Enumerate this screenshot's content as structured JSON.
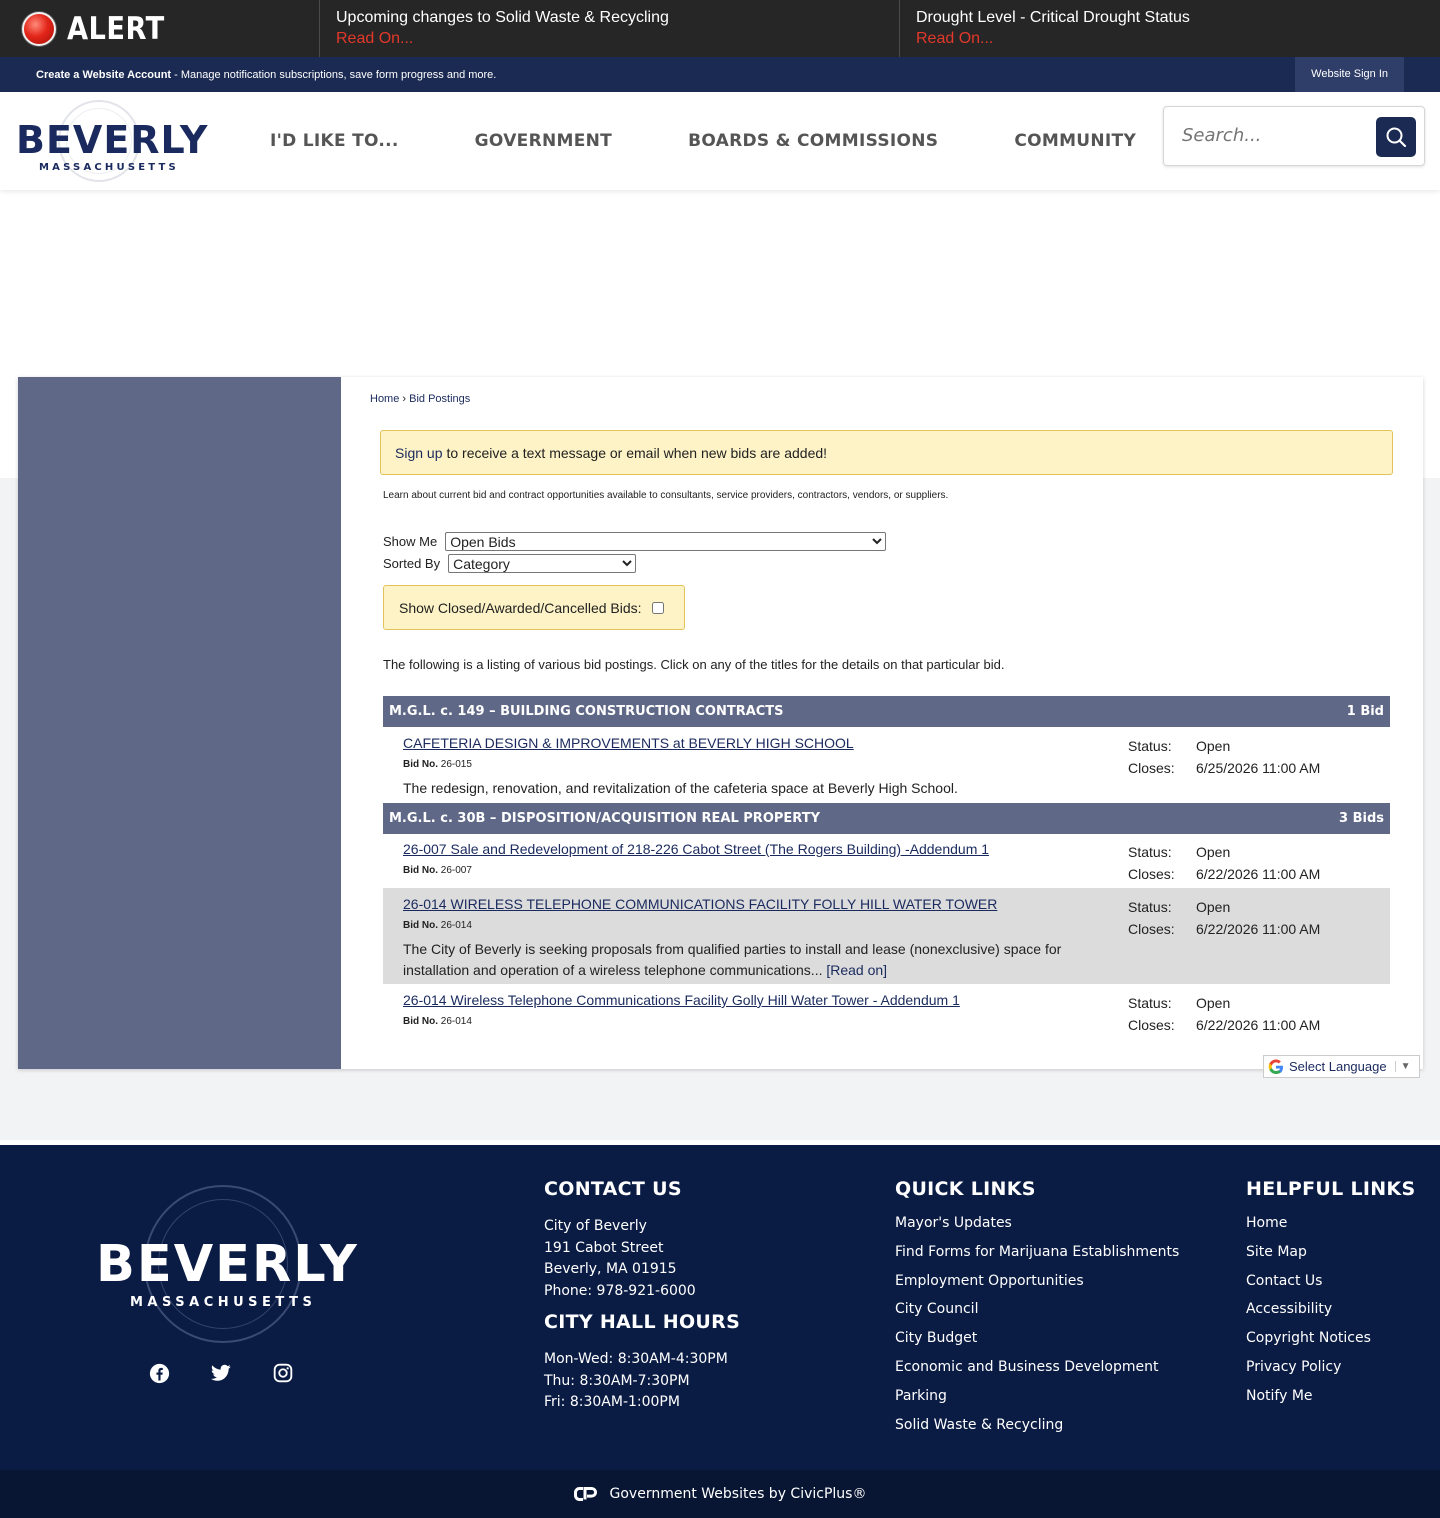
{
  "alert": {
    "label": "ALERT",
    "items": [
      {
        "title": "Upcoming changes to Solid Waste & Recycling",
        "link": "Read On..."
      },
      {
        "title": "Drought Level - Critical Drought Status",
        "link": "Read On..."
      }
    ]
  },
  "account": {
    "create_bold": "Create a Website Account",
    "create_rest": " - Manage notification subscriptions, save form progress and more.",
    "signin": "Website Sign In"
  },
  "header": {
    "logo_word": "BEVERLY",
    "logo_sub": "MASSACHUSETTS",
    "nav": [
      "I'D LIKE TO...",
      "GOVERNMENT",
      "BOARDS & COMMISSIONS",
      "COMMUNITY"
    ],
    "search_placeholder": "Search..."
  },
  "breadcrumb": {
    "home": "Home",
    "sep": " › ",
    "current": "Bid Postings"
  },
  "notice": {
    "link": "Sign up",
    "text": "to receive a text message or email when new bids are added!"
  },
  "intro": "Learn about current bid and contract opportunities available to consultants, service providers, contractors, vendors, or suppliers.",
  "filters": {
    "show_me_label": "Show Me",
    "show_me_value": "Open Bids",
    "sorted_by_label": "Sorted By",
    "sorted_by_value": "Category",
    "closed_label": "Show Closed/Awarded/Cancelled Bids:"
  },
  "listing_intro": "The following is a listing of various bid postings. Click on any of the titles for the details on that particular bid.",
  "categories": [
    {
      "name": "M.G.L. c. 149 – BUILDING CONSTRUCTION CONTRACTS",
      "count": "1 Bid",
      "bids": [
        {
          "title": "CAFETERIA DESIGN & IMPROVEMENTS at BEVERLY HIGH SCHOOL",
          "bid_no_label": "Bid No.",
          "bid_no": "26-015",
          "desc": "The redesign, renovation, and revitalization of the cafeteria space at Beverly High School.",
          "read_on": "",
          "status_label": "Status:",
          "status": "Open",
          "closes_label": "Closes:",
          "closes": "6/25/2026 11:00 AM"
        }
      ]
    },
    {
      "name": "M.G.L. c. 30B – DISPOSITION/ACQUISITION REAL PROPERTY",
      "count": "3 Bids",
      "bids": [
        {
          "title": "26-007 Sale and Redevelopment of 218-226 Cabot Street (The Rogers Building) -Addendum 1",
          "bid_no_label": "Bid No.",
          "bid_no": "26-007",
          "desc": "",
          "read_on": "",
          "status_label": "Status:",
          "status": "Open",
          "closes_label": "Closes:",
          "closes": "6/22/2026 11:00 AM"
        },
        {
          "title": "26-014 WIRELESS TELEPHONE COMMUNICATIONS FACILITY FOLLY HILL WATER TOWER",
          "bid_no_label": "Bid No.",
          "bid_no": "26-014",
          "desc": "The City of Beverly is seeking proposals from qualified parties to install and lease (nonexclusive) space for installation and operation of a wireless telephone communications... ",
          "read_on": "[Read on]",
          "status_label": "Status:",
          "status": "Open",
          "closes_label": "Closes:",
          "closes": "6/22/2026 11:00 AM"
        },
        {
          "title": "26-014 Wireless Telephone Communications Facility Golly Hill Water Tower - Addendum 1",
          "bid_no_label": "Bid No.",
          "bid_no": "26-014",
          "desc": "",
          "read_on": "",
          "status_label": "Status:",
          "status": "Open",
          "closes_label": "Closes:",
          "closes": "6/22/2026 11:00 AM"
        }
      ]
    }
  ],
  "language": {
    "label": "Select Language",
    "arrow": "▼"
  },
  "footer": {
    "logo_word": "BEVERLY",
    "logo_sub": "MASSACHUSETTS",
    "social": [
      "facebook-icon",
      "twitter-icon",
      "instagram-icon"
    ],
    "contact": {
      "heading": "CONTACT US",
      "lines": [
        "City of Beverly",
        "191 Cabot Street",
        "Beverly, MA 01915",
        "Phone: 978-921-6000"
      ],
      "hours_heading": "CITY HALL HOURS",
      "hours": [
        "Mon-Wed: 8:30AM-4:30PM",
        "Thu: 8:30AM-7:30PM",
        "Fri: 8:30AM-1:00PM"
      ]
    },
    "quick_links": {
      "heading": "QUICK LINKS",
      "items": [
        "Mayor's Updates",
        "Find Forms for Marijuana Establishments",
        "Employment Opportunities",
        "City Council",
        "City Budget",
        "Economic and Business Development",
        "Parking",
        "Solid Waste & Recycling"
      ]
    },
    "helpful_links": {
      "heading": "HELPFUL LINKS",
      "items": [
        "Home",
        "Site Map",
        "Contact Us",
        "Accessibility",
        "Copyright Notices",
        "Privacy Policy",
        "Notify Me"
      ]
    },
    "civicplus": "Government Websites by CivicPlus®"
  },
  "colors": {
    "navy": "#1b2a52",
    "slate": "#5f6886",
    "alert_red": "#e3382a",
    "notice_bg": "#fdf3c6"
  }
}
